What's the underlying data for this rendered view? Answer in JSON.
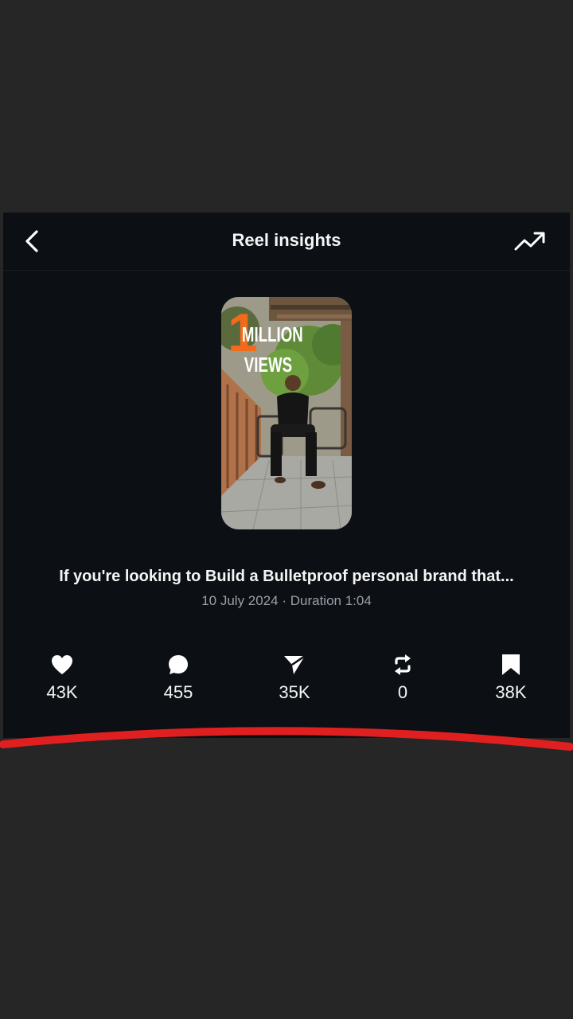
{
  "header": {
    "title": "Reel insights",
    "back_icon": "chevron-left-icon",
    "trend_icon": "trending-up-icon"
  },
  "thumbnail": {
    "overlay_number": "1",
    "overlay_line1": "MILLION",
    "overlay_line2": "VIEWS"
  },
  "reel": {
    "caption": "If you're looking to Build a Bulletproof personal brand that...",
    "meta": "10 July 2024 · Duration 1:04"
  },
  "stats": [
    {
      "icon": "heart-icon",
      "value": "43K"
    },
    {
      "icon": "comment-icon",
      "value": "455"
    },
    {
      "icon": "send-icon",
      "value": "35K"
    },
    {
      "icon": "repost-icon",
      "value": "0"
    },
    {
      "icon": "bookmark-icon",
      "value": "38K"
    }
  ],
  "colors": {
    "panel_bg": "#0c0f14",
    "page_bg": "#262626",
    "annotation_red": "#e02020",
    "overlay_orange": "#f26a1b"
  }
}
